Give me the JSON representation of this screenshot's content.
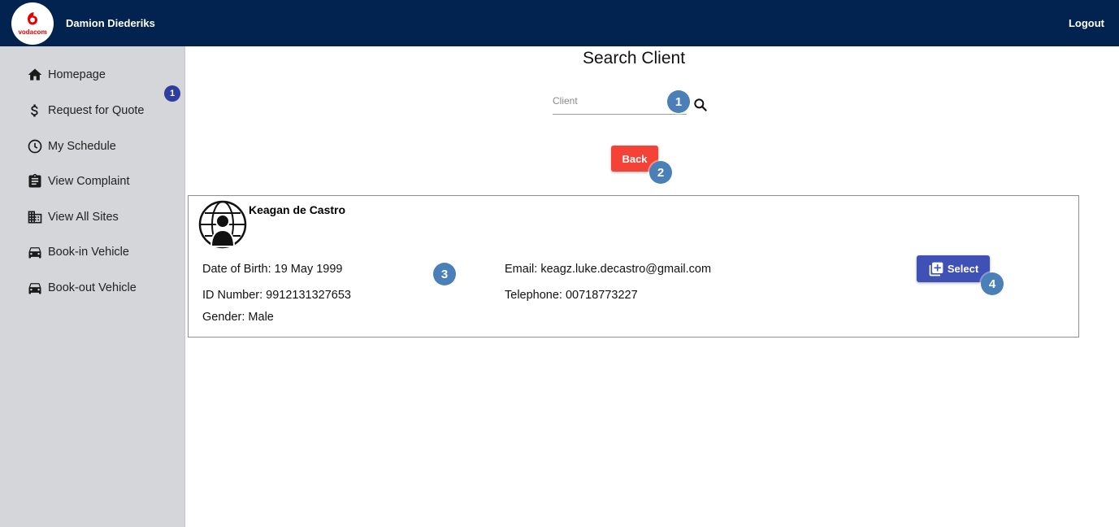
{
  "header": {
    "logo_text": "vodacom",
    "user_name": "Damion Diederiks",
    "logout_label": "Logout"
  },
  "sidebar": {
    "badge": "1",
    "items": [
      {
        "label": "Homepage",
        "icon": "home-icon"
      },
      {
        "label": "Request for Quote",
        "icon": "dollar-icon"
      },
      {
        "label": "My Schedule",
        "icon": "clock-icon"
      },
      {
        "label": "View Complaint",
        "icon": "clipboard-icon"
      },
      {
        "label": "View All Sites",
        "icon": "building-icon"
      },
      {
        "label": "Book-in Vehicle",
        "icon": "car-icon"
      },
      {
        "label": "Book-out Vehicle",
        "icon": "car-icon"
      }
    ]
  },
  "main": {
    "title": "Search Client",
    "search": {
      "placeholder": "Client",
      "value": ""
    },
    "back_label": "Back",
    "markers": [
      "1",
      "2",
      "3",
      "4"
    ]
  },
  "client": {
    "name": "Keagan de Castro",
    "dob": "Date of Birth: 19 May 1999",
    "id_number": "ID Number: 9912131327653",
    "gender": "Gender: Male",
    "email": "Email: keagz.luke.decastro@gmail.com",
    "telephone": "Telephone: 00718773227",
    "select_label": "Select"
  },
  "colors": {
    "header_bg": "#022250",
    "sidebar_bg": "#d5d6da",
    "back_button": "#f44336",
    "select_button": "#3f51b5",
    "marker": "#4b7fb8"
  }
}
